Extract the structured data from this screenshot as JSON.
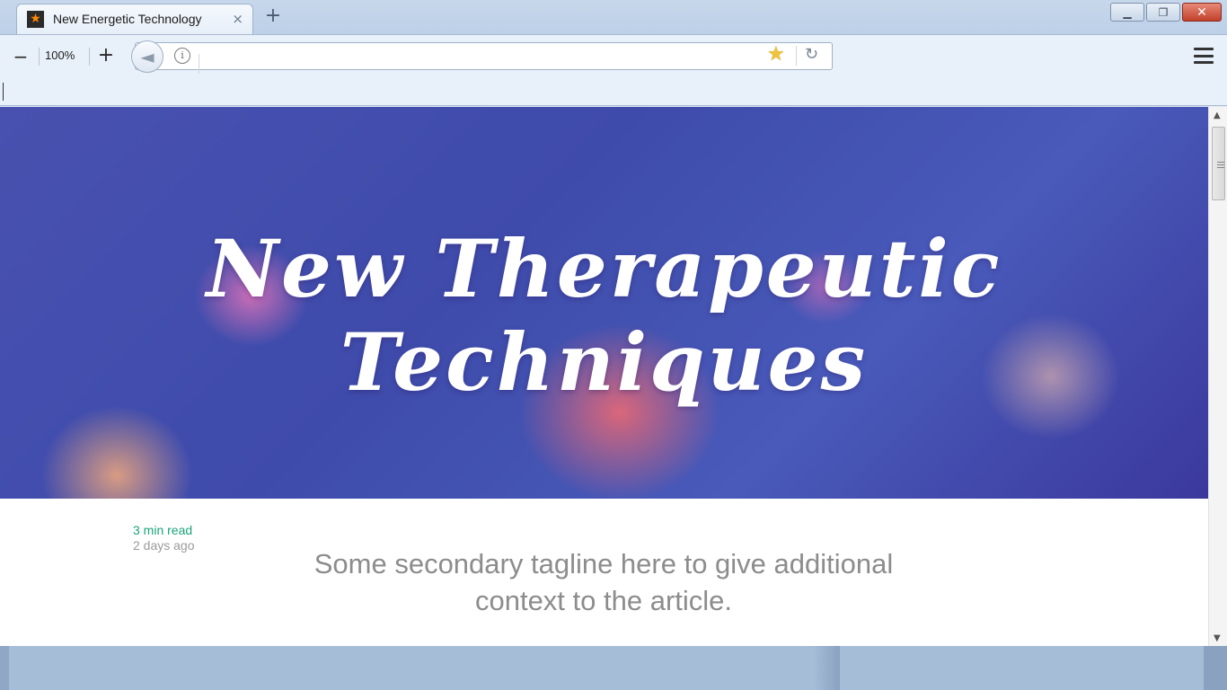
{
  "browser": {
    "tab": {
      "title": "New Energetic Technology",
      "favicon": "star-icon",
      "close_label": "×"
    },
    "new_tab_label": "+",
    "window_controls": {
      "minimize": "▁",
      "restore": "❐",
      "close": "✕"
    },
    "zoom": {
      "out_label": "−",
      "level": "100%",
      "in_label": "+"
    },
    "url": {
      "value": ""
    },
    "icons": {
      "back": "◄",
      "info": "i",
      "bookmark_star": "★",
      "reload": "↻"
    }
  },
  "article": {
    "hero_title_line1": "New Therapeutic",
    "hero_title_line2": "Techniques",
    "read_time": "3 min read",
    "posted": "2 days ago",
    "tagline": "Some secondary tagline here to give additional context to the article."
  },
  "colors": {
    "accent_green": "#1aa37a",
    "meta_gray": "#9a9a9a",
    "hero_blue": "#4a55b5"
  }
}
